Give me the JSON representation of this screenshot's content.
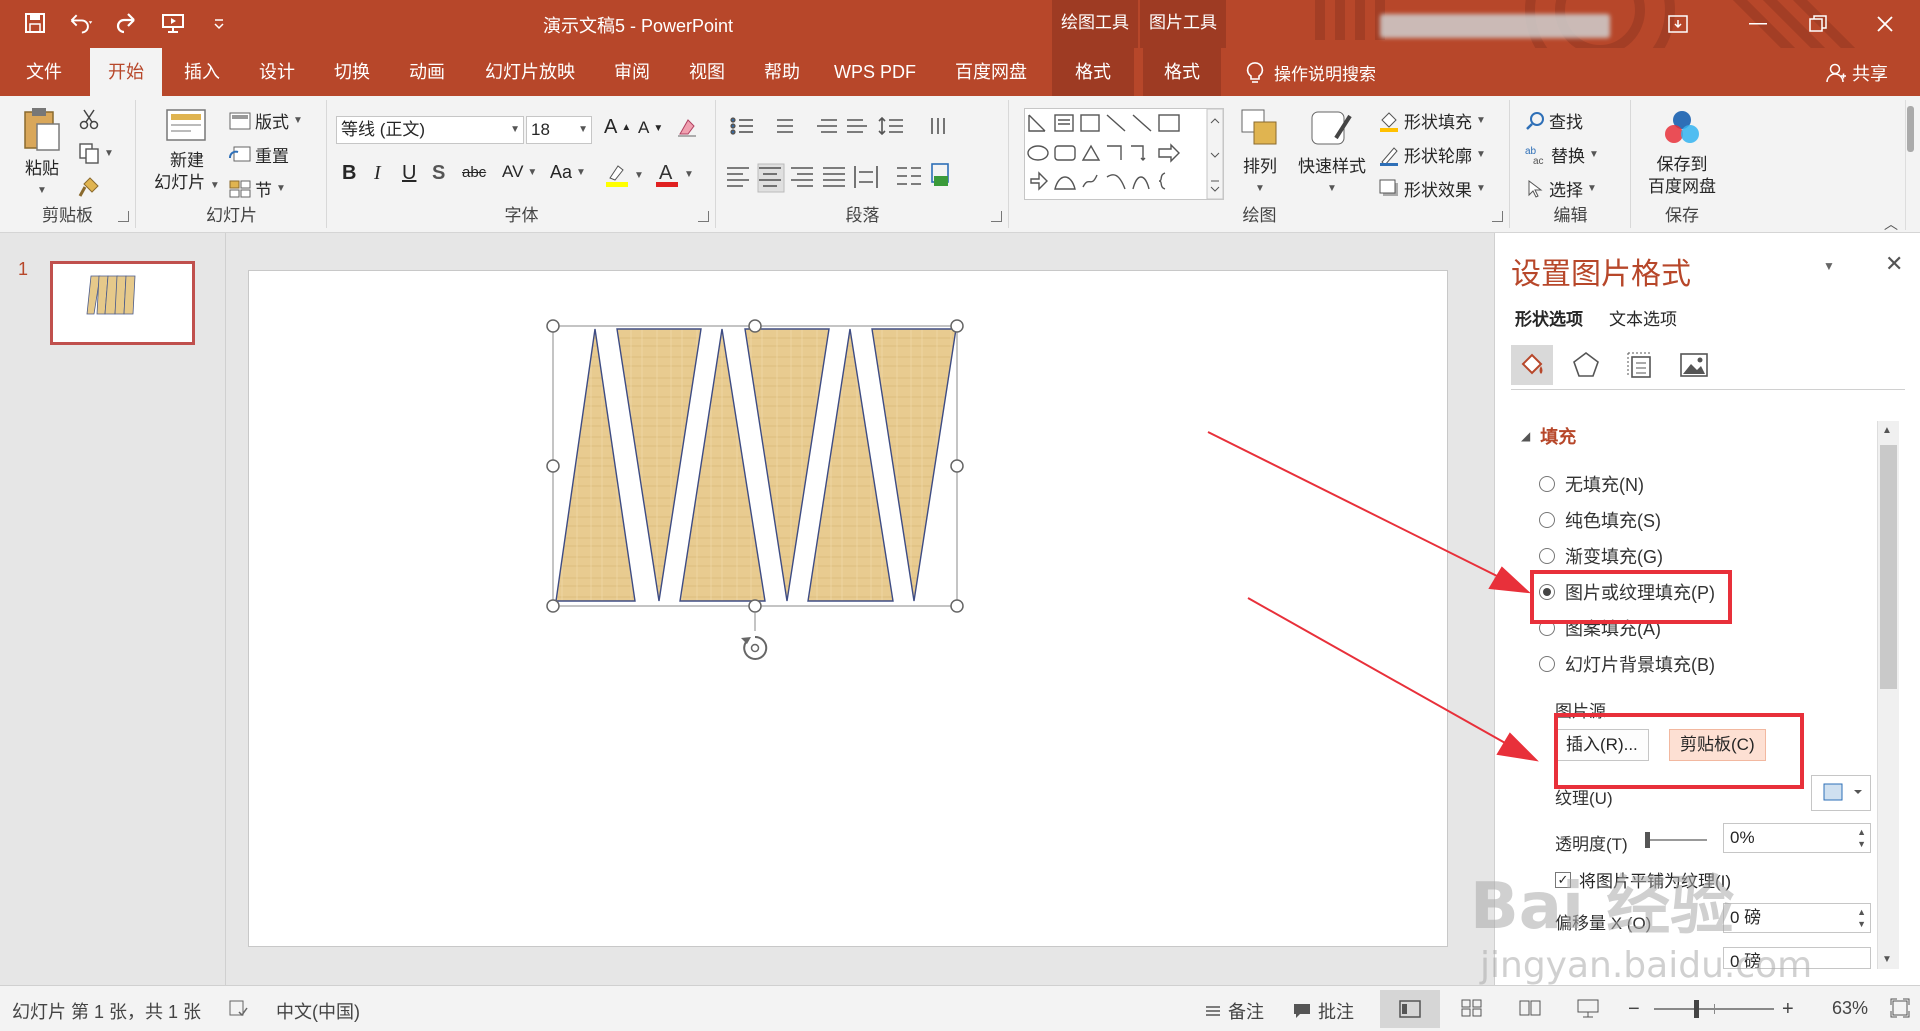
{
  "window": {
    "doc_title": "演示文稿5 - PowerPoint",
    "context_tabs": [
      "绘图工具",
      "图片工具"
    ],
    "accent": "#b7472a"
  },
  "ribbon_tabs": [
    "文件",
    "开始",
    "插入",
    "设计",
    "切换",
    "动画",
    "幻灯片放映",
    "审阅",
    "视图",
    "帮助",
    "WPS PDF",
    "百度网盘",
    "格式",
    "格式"
  ],
  "active_tab": "开始",
  "tell_me": "操作说明搜索",
  "share": "共享",
  "groups": {
    "clipboard": {
      "label": "剪贴板",
      "paste": "粘贴"
    },
    "slides": {
      "label": "幻灯片",
      "new_slide_1": "新建",
      "new_slide_2": "幻灯片",
      "layout": "版式",
      "reset": "重置",
      "section": "节"
    },
    "font": {
      "label": "字体",
      "font_name": "等线 (正文)",
      "font_size": "18"
    },
    "paragraph": {
      "label": "段落"
    },
    "drawing": {
      "label": "绘图",
      "arrange": "排列",
      "quick_styles": "快速样式",
      "shape_fill": "形状填充",
      "shape_outline": "形状轮廓",
      "shape_effects": "形状效果"
    },
    "editing": {
      "label": "编辑",
      "find": "查找",
      "replace": "替换",
      "select": "选择"
    },
    "save": {
      "label": "保存",
      "save_to_1": "保存到",
      "save_to_2": "百度网盘"
    }
  },
  "thumbnail": {
    "number": "1"
  },
  "format_pane": {
    "title": "设置图片格式",
    "tabs": [
      "形状选项",
      "文本选项"
    ],
    "fill_section": "填充",
    "fill_options": [
      "无填充(N)",
      "纯色填充(S)",
      "渐变填充(G)",
      "图片或纹理填充(P)",
      "图案填充(A)",
      "幻灯片背景填充(B)"
    ],
    "selected_fill": "图片或纹理填充(P)",
    "picture_source": "图片源",
    "insert_btn": "插入(R)...",
    "clipboard_btn": "剪贴板(C)",
    "texture": "纹理(U)",
    "transparency_label": "透明度(T)",
    "transparency_value": "0%",
    "tile_label": "将图片平铺为纹理(I)",
    "offset_x_label": "偏移量 X (O)",
    "offset_x_value": "0 磅",
    "offset_y_value": "0 磅"
  },
  "status": {
    "slide_info": "幻灯片 第 1 张，共 1 张",
    "language": "中文(中国)",
    "notes": "备注",
    "comments": "批注",
    "zoom": "63%"
  },
  "watermark": {
    "logo": "Bai 经验",
    "url": "jingyan.baidu.com"
  }
}
